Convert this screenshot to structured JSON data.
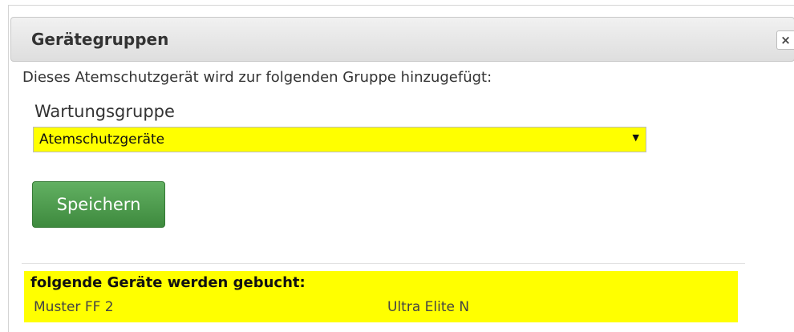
{
  "dialog": {
    "title": "Gerätegruppen",
    "close_label": "×",
    "intro_text": "Dieses Atemschutzgerät wird zur folgenden Gruppe hinzugefügt:",
    "group_field": {
      "label": "Wartungsgruppe",
      "selected_value": "Atemschutzgeräte"
    },
    "save_label": "Speichern",
    "booking": {
      "heading": "folgende Geräte werden gebucht:",
      "rows": [
        [
          "Muster FF 2",
          "Ultra Elite N"
        ]
      ]
    }
  },
  "colors": {
    "highlight": "#ffff00",
    "save_button": "#4e9c4e"
  },
  "icons": {
    "close": "close-icon",
    "dropdown": "chevron-down-icon"
  }
}
